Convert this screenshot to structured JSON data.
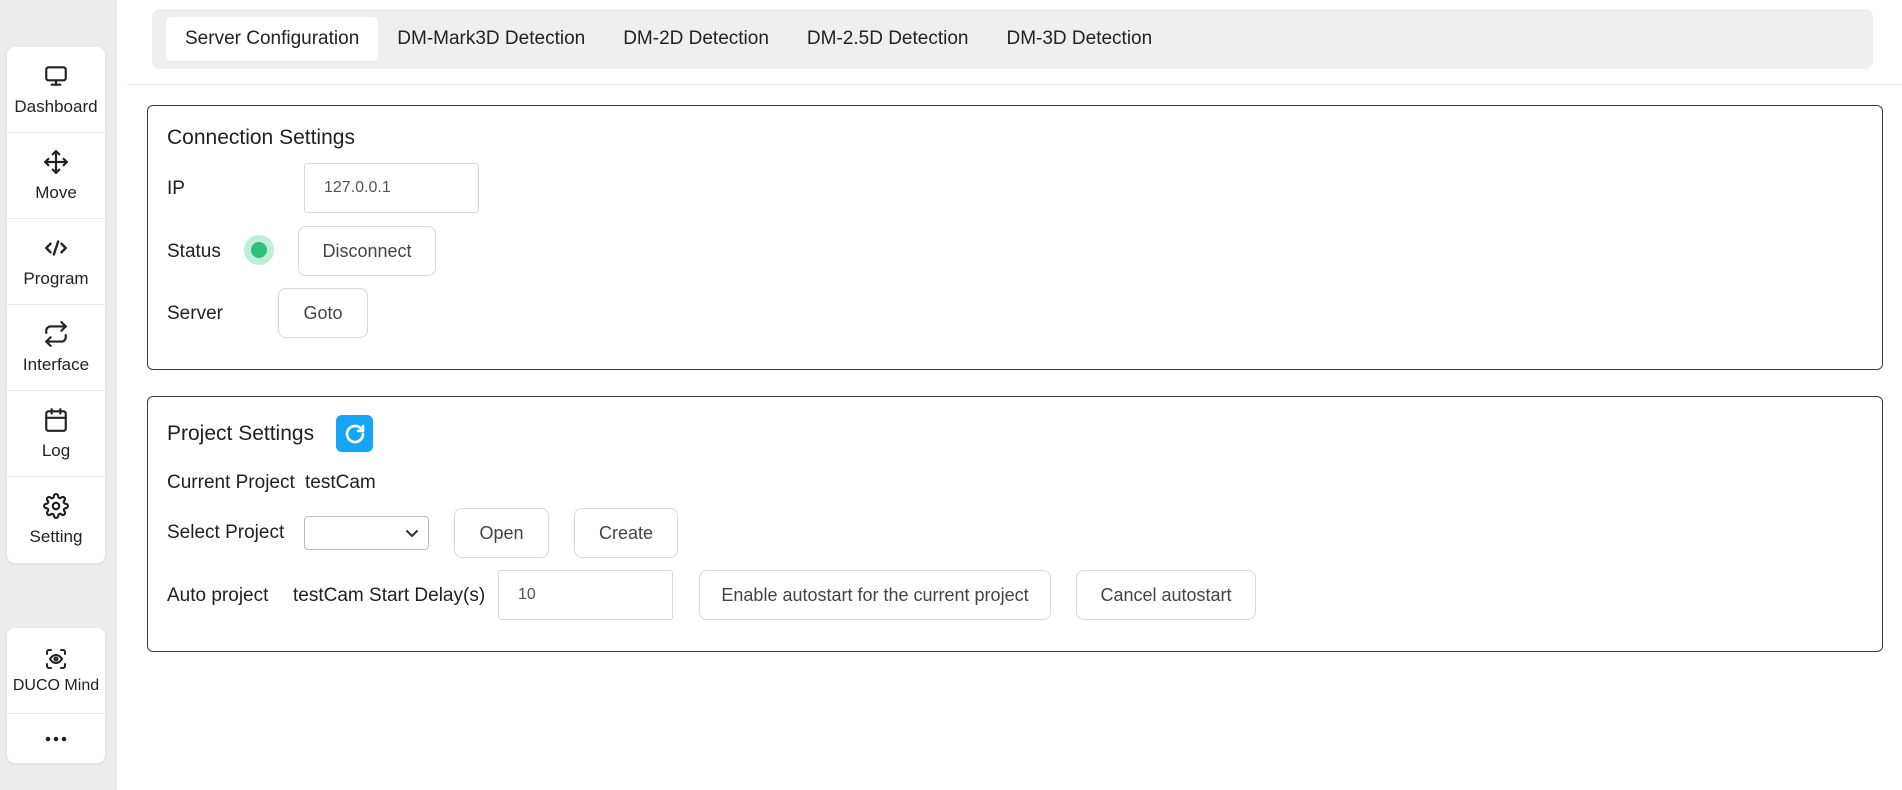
{
  "sidebar": {
    "items": [
      {
        "label": "Dashboard",
        "icon": "monitor-icon"
      },
      {
        "label": "Move",
        "icon": "move-arrows-icon"
      },
      {
        "label": "Program",
        "icon": "code-icon"
      },
      {
        "label": "Interface",
        "icon": "swap-arrows-icon"
      },
      {
        "label": "Log",
        "icon": "calendar-icon"
      },
      {
        "label": "Setting",
        "icon": "gear-icon"
      }
    ],
    "bottom_items": [
      {
        "label": "DUCO Mind",
        "icon": "eye-scan-icon"
      },
      {
        "label": "",
        "icon": "more-dots-icon"
      }
    ]
  },
  "tabs": [
    {
      "label": "Server Configuration",
      "active": true
    },
    {
      "label": "DM-Mark3D Detection",
      "active": false
    },
    {
      "label": "DM-2D Detection",
      "active": false
    },
    {
      "label": "DM-2.5D Detection",
      "active": false
    },
    {
      "label": "DM-3D Detection",
      "active": false
    }
  ],
  "connection": {
    "title": "Connection Settings",
    "ip_label": "IP",
    "ip_value": "127.0.0.1",
    "status_label": "Status",
    "status_color": "#2fc07c",
    "disconnect_label": "Disconnect",
    "server_label": "Server",
    "goto_label": "Goto"
  },
  "project": {
    "title": "Project Settings",
    "refresh_icon": "refresh-icon",
    "current_label": "Current Project",
    "current_value": "testCam",
    "select_label": "Select Project",
    "select_value": "",
    "open_label": "Open",
    "create_label": "Create",
    "auto_label": "Auto project",
    "auto_text": "testCam Start Delay(s)",
    "delay_value": "10",
    "enable_label": "Enable autostart for the current project",
    "cancel_label": "Cancel autostart"
  },
  "colors": {
    "accent": "#16a4f4",
    "status_ok": "#2fc07c"
  }
}
